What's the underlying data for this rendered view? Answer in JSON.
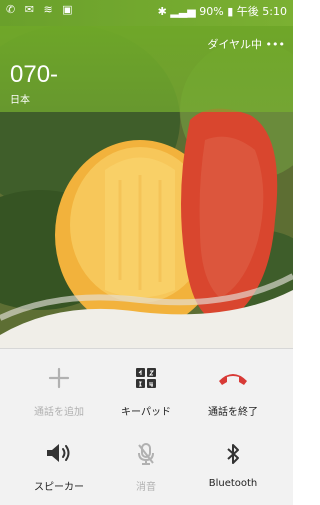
{
  "status_bar": {
    "left_icons": [
      "phone-icon",
      "message-icon",
      "signal-indicator-icon",
      "sim-icon"
    ],
    "bluetooth_icon": "bluetooth-icon",
    "signal_icon": "signal-icon",
    "battery_percent": "90%",
    "time": "午後 5:10"
  },
  "call": {
    "state": "ダイヤル中 •••",
    "number": "070-",
    "region": "日本"
  },
  "controls": {
    "add_call": {
      "label": "通話を追加",
      "icon": "plus-icon",
      "enabled": false
    },
    "keypad": {
      "label": "キーパッド",
      "icon": "keypad-icon"
    },
    "end_call": {
      "label": "通話を終了",
      "icon": "end-call-icon",
      "color": "#d83a36"
    },
    "speaker": {
      "label": "スピーカー",
      "icon": "speaker-icon"
    },
    "mute": {
      "label": "消音",
      "icon": "mute-mic-icon",
      "enabled": false
    },
    "bluetooth": {
      "label": "Bluetooth",
      "icon": "bluetooth-icon"
    }
  },
  "colors": {
    "header_green": "#6aa02b",
    "end_call_red": "#d83a36",
    "disabled_gray": "#b1b1b1"
  }
}
